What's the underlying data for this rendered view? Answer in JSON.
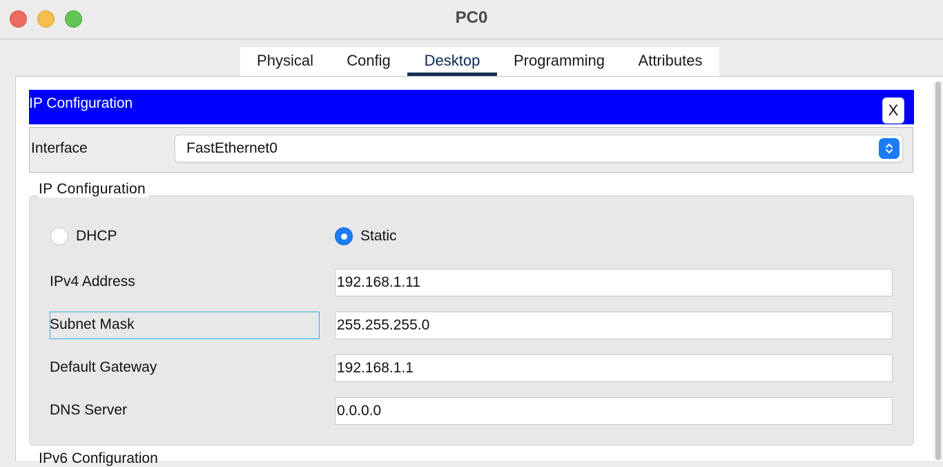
{
  "window": {
    "title": "PC0"
  },
  "tabs": [
    {
      "label": "Physical"
    },
    {
      "label": "Config"
    },
    {
      "label": "Desktop"
    },
    {
      "label": "Programming"
    },
    {
      "label": "Attributes"
    }
  ],
  "active_tab": "Desktop",
  "ip_config": {
    "header_title": "IP Configuration",
    "close_label": "X",
    "interface_label": "Interface",
    "interface_value": "FastEthernet0",
    "section_title": "IP Configuration",
    "dhcp_label": "DHCP",
    "static_label": "Static",
    "selected_mode": "Static",
    "fields": {
      "ipv4": {
        "label": "IPv4 Address",
        "value": "192.168.1.11"
      },
      "subnet": {
        "label": "Subnet Mask",
        "value": "255.255.255.0"
      },
      "gateway": {
        "label": "Default Gateway",
        "value": "192.168.1.1"
      },
      "dns": {
        "label": "DNS Server",
        "value": "0.0.0.0"
      }
    },
    "ipv6_section_title": "IPv6 Configuration"
  },
  "colors": {
    "header_blue": "#0000ff",
    "accent_blue": "#1b7cf4",
    "active_tab_underline": "#112d54"
  }
}
